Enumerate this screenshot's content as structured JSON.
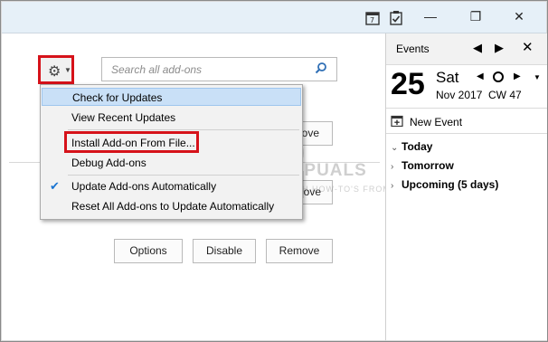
{
  "titlebar": {
    "icons": [
      "calendar-icon",
      "task-icon"
    ],
    "buttons": {
      "minimize": "—",
      "restore": "❐",
      "close": "✕"
    }
  },
  "toolbar": {
    "gear_icon": "gear-icon",
    "search_placeholder": "Search all add-ons"
  },
  "menu": {
    "items": [
      {
        "label": "Check for Updates",
        "highlighted": true
      },
      {
        "label": "View Recent Updates"
      },
      {
        "label": "Install Add-on From File..."
      },
      {
        "label": "Debug Add-ons"
      },
      {
        "label": "Update Add-ons Automatically",
        "checked": true
      },
      {
        "label": "Reset All Add-ons to Update Automatically"
      }
    ]
  },
  "addon_rows": [
    {
      "buttons": [
        "move"
      ]
    },
    {
      "buttons": [
        "ove"
      ]
    },
    {
      "buttons": [
        "Options",
        "Disable",
        "Remove"
      ]
    }
  ],
  "watermark": {
    "title": "APPUALS",
    "sub": "TECH HOW-TO'S FROM THE EXPERTS!"
  },
  "sidebar": {
    "title": "Events",
    "day_number": "25",
    "day_name": "Sat",
    "month_year": "Nov 2017",
    "week": "CW 47",
    "new_event_label": "New Event",
    "events": [
      {
        "label": "Today",
        "expanded": true
      },
      {
        "label": "Tomorrow",
        "expanded": false
      },
      {
        "label": "Upcoming (5 days)",
        "expanded": false
      }
    ]
  },
  "colors": {
    "accent_red": "#d6121a",
    "highlight": "#c9e0f7",
    "check_blue": "#1a75d2"
  }
}
